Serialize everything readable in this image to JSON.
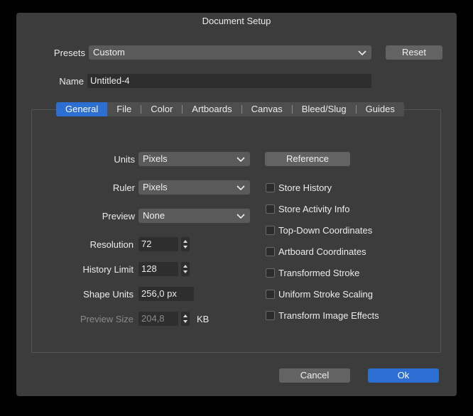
{
  "window": {
    "title": "Document Setup"
  },
  "presets": {
    "label": "Presets",
    "value": "Custom",
    "reset_label": "Reset"
  },
  "name": {
    "label": "Name",
    "value": "Untitled-4"
  },
  "tabs": [
    {
      "label": "General",
      "active": true
    },
    {
      "label": "File"
    },
    {
      "label": "Color"
    },
    {
      "label": "Artboards"
    },
    {
      "label": "Canvas"
    },
    {
      "label": "Bleed/Slug"
    },
    {
      "label": "Guides"
    }
  ],
  "general": {
    "units": {
      "label": "Units",
      "value": "Pixels"
    },
    "ruler": {
      "label": "Ruler",
      "value": "Pixels"
    },
    "preview": {
      "label": "Preview",
      "value": "None"
    },
    "resolution": {
      "label": "Resolution",
      "value": "72"
    },
    "history_limit": {
      "label": "History Limit",
      "value": "128"
    },
    "shape_units": {
      "label": "Shape Units",
      "value": "256,0 px"
    },
    "preview_size": {
      "label": "Preview Size",
      "value": "204,8",
      "unit": "KB"
    },
    "reference_label": "Reference",
    "checkboxes": [
      {
        "label": "Store History",
        "checked": false
      },
      {
        "label": "Store Activity Info",
        "checked": false
      },
      {
        "label": "Top-Down Coordinates",
        "checked": false
      },
      {
        "label": "Artboard Coordinates",
        "checked": false
      },
      {
        "label": "Transformed Stroke",
        "checked": false
      },
      {
        "label": "Uniform Stroke Scaling",
        "checked": false
      },
      {
        "label": "Transform Image Effects",
        "checked": false
      }
    ]
  },
  "footer": {
    "cancel_label": "Cancel",
    "ok_label": "Ok"
  },
  "colors": {
    "accent": "#2d6ed3",
    "dialog_bg": "#3c3c3c"
  },
  "icons": {
    "dropdown": "chevron-down-icon",
    "stepper": "stepper-arrows-icon"
  }
}
